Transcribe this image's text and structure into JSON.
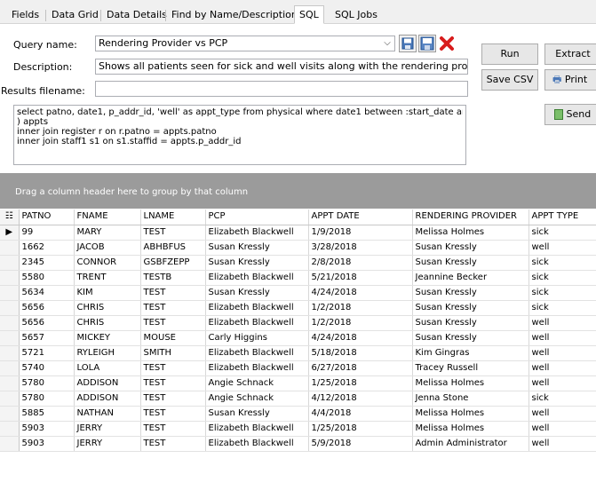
{
  "tabs": [
    {
      "label": "Fields",
      "active": false
    },
    {
      "label": "Data Grid",
      "active": false
    },
    {
      "label": "Data Details",
      "active": false
    },
    {
      "label": "Find by Name/Description",
      "active": false
    },
    {
      "label": "SQL",
      "active": true
    },
    {
      "label": "SQL Jobs",
      "active": false
    }
  ],
  "form": {
    "query_name_label": "Query name:",
    "query_name_value": "Rendering Provider vs PCP",
    "description_label": "Description:",
    "description_value": "Shows all patients seen for sick and well visits along with the rendering provider fo",
    "results_filename_label": "Results filename:",
    "results_filename_value": ""
  },
  "buttons": {
    "run": "Run",
    "extract": "Extract",
    "save_csv": "Save CSV",
    "print": "Print",
    "send": "Send"
  },
  "sql_lines": [
    "select patno, date1, p_addr_id, 'well' as appt_type from physical where date1 between :start_date and :end_Date",
    ") appts",
    "inner join register r on r.patno = appts.patno",
    "inner join staff1 s1 on s1.staffid = appts.p_addr_id"
  ],
  "group_bar_text": "Drag a column header here to group by that column",
  "grid": {
    "columns": [
      "PATNO",
      "FNAME",
      "LNAME",
      "PCP",
      "APPT DATE",
      "RENDERING PROVIDER",
      "APPT TYPE"
    ],
    "current_row_marker": "▶",
    "rows": [
      [
        "99",
        "MARY",
        "TEST",
        "Elizabeth Blackwell",
        "1/9/2018",
        "Melissa Holmes",
        "sick"
      ],
      [
        "1662",
        "JACOB",
        "ABHBFUS",
        "Susan Kressly",
        "3/28/2018",
        "Susan Kressly",
        "well"
      ],
      [
        "2345",
        "CONNOR",
        "GSBFZEPP",
        "Susan Kressly",
        "2/8/2018",
        "Susan Kressly",
        "sick"
      ],
      [
        "5580",
        "TRENT",
        "TESTB",
        "Elizabeth Blackwell",
        "5/21/2018",
        "Jeannine Becker",
        "sick"
      ],
      [
        "5634",
        "KIM",
        "TEST",
        "Susan Kressly",
        "4/24/2018",
        "Susan Kressly",
        "sick"
      ],
      [
        "5656",
        "CHRIS",
        "TEST",
        "Elizabeth Blackwell",
        "1/2/2018",
        "Susan Kressly",
        "sick"
      ],
      [
        "5656",
        "CHRIS",
        "TEST",
        "Elizabeth Blackwell",
        "1/2/2018",
        "Susan Kressly",
        "well"
      ],
      [
        "5657",
        "MICKEY",
        "MOUSE",
        "Carly Higgins",
        "4/24/2018",
        "Susan Kressly",
        "well"
      ],
      [
        "5721",
        "RYLEIGH",
        "SMITH",
        "Elizabeth Blackwell",
        "5/18/2018",
        "Kim  Gingras",
        "well"
      ],
      [
        "5740",
        "LOLA",
        "TEST",
        "Elizabeth Blackwell",
        "6/27/2018",
        "Tracey Russell",
        "well"
      ],
      [
        "5780",
        "ADDISON",
        "TEST",
        "Angie Schnack",
        "1/25/2018",
        "Melissa Holmes",
        "well"
      ],
      [
        "5780",
        "ADDISON",
        "TEST",
        "Angie Schnack",
        "4/12/2018",
        "Jenna Stone",
        "sick"
      ],
      [
        "5885",
        "NATHAN",
        "TEST",
        "Susan Kressly",
        "4/4/2018",
        "Melissa Holmes",
        "well"
      ],
      [
        "5903",
        "JERRY",
        "TEST",
        "Elizabeth Blackwell",
        "1/25/2018",
        "Melissa Holmes",
        "well"
      ],
      [
        "5903",
        "JERRY",
        "TEST",
        "Elizabeth Blackwell",
        "5/9/2018",
        "Admin Administrator",
        "well"
      ]
    ]
  },
  "icons": {
    "save": "save-icon",
    "save_as": "save-as-icon",
    "delete": "delete-icon",
    "print": "printer-icon",
    "send": "send-icon",
    "combo": "chevron-down-icon",
    "column_chooser": "column-chooser-icon"
  },
  "colors": {
    "group_bar": "#9b9b9b",
    "delete_red": "#d81b1b",
    "save_blue": "#1f4f8f"
  }
}
